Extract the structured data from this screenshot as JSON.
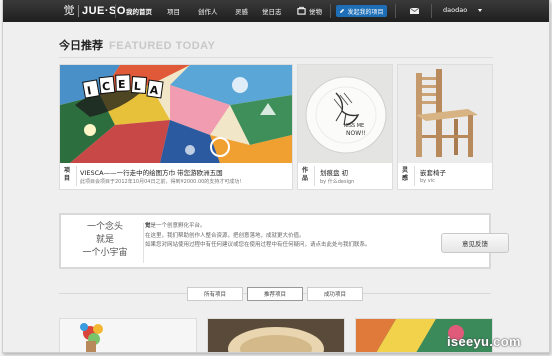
{
  "brand": {
    "mark": "觉",
    "name": "JUE·SO"
  },
  "nav": {
    "items": [
      "我的首页",
      "项目",
      "创作人",
      "灵感",
      "觉日志",
      "觉物"
    ],
    "create_label": "发起我的项目",
    "user": "daodao"
  },
  "featured": {
    "title_cn": "今日推荐",
    "title_en": "FEATURED TODAY",
    "main": {
      "type": "项目",
      "title": "VIESCA——一行走中的绘图方巾 带您游欧洲五国",
      "subtitle": "此项目会项目于2012年10月04日之前，得到¥2000.00的支持才可成功!"
    },
    "cards": [
      {
        "type": "作品",
        "title": "划痕盘 初",
        "by": "by 什么design"
      },
      {
        "type": "灵感",
        "title": "嵌套椅子",
        "by": "by vic"
      }
    ]
  },
  "about": {
    "slogan": [
      "一个念头",
      "就是",
      "一个小宇宙"
    ],
    "brand_word": "觉",
    "intro_line1": "是一个创意孵化平台。",
    "intro_line2": "在这里，我们帮助创作人整合资源，把创意落地，成就更大价值。",
    "intro_line3": "如果您对网站使用过程中有任何建议或您在使用过程中有任何疑问，请点击此处与我们联系。",
    "feedback_label": "意见反馈"
  },
  "tabs": [
    "所有项目",
    "推荐项目",
    "成功项目"
  ],
  "active_tab": "推荐项目",
  "watermark": "iseeyu.com",
  "colors": {
    "topbar": "#2b2b2b",
    "accent": "#1e6fb8"
  }
}
